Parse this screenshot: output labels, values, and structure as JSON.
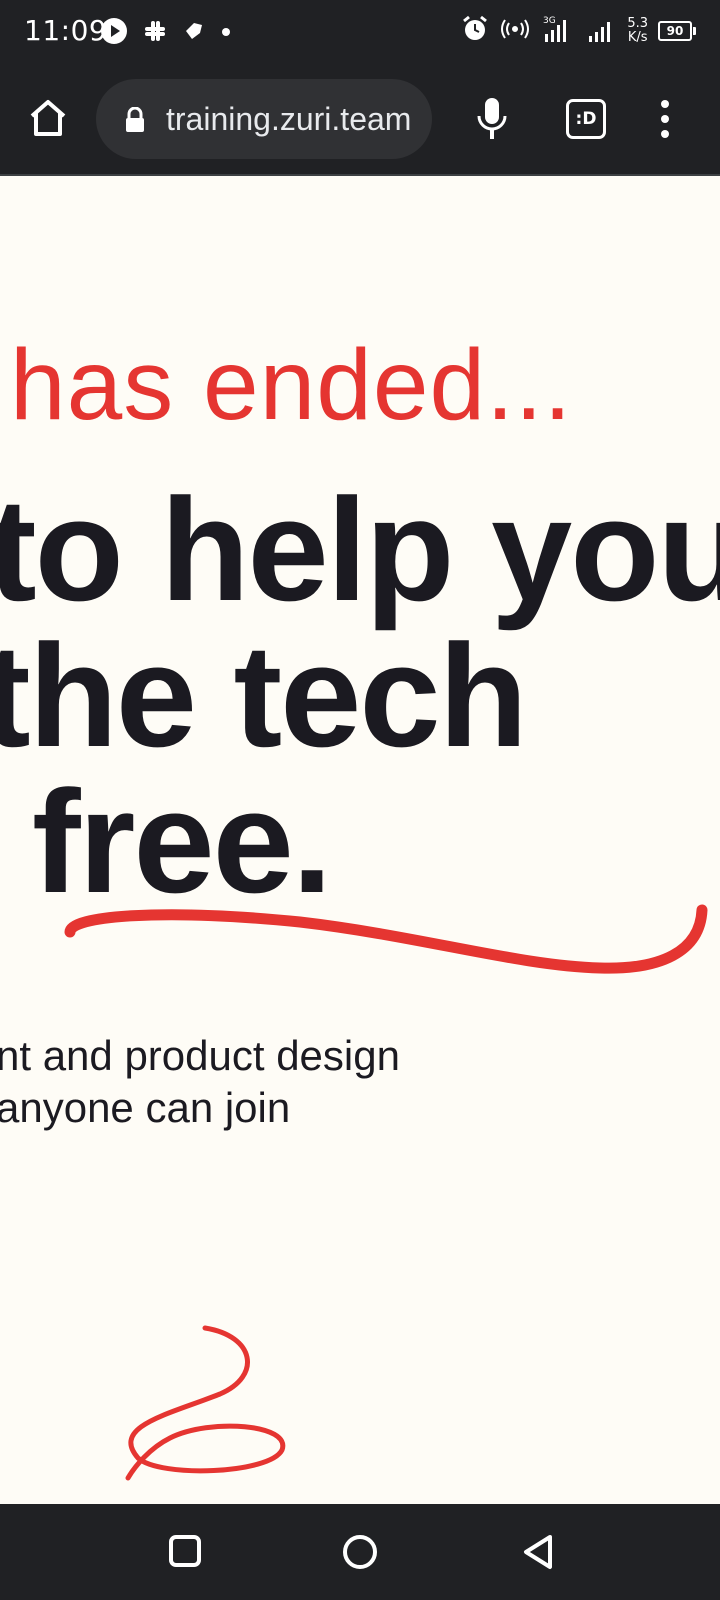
{
  "status_bar": {
    "time": "11:09",
    "net_speed_value": "5.3",
    "net_speed_unit": "K/s",
    "battery": "90",
    "network_label": "3G"
  },
  "toolbar": {
    "url": "training.zuri.team",
    "tabs_label": ":D"
  },
  "page": {
    "subtitle": "has ended...",
    "headline_lines": [
      "to help you",
      "the tech",
      "free."
    ],
    "body_lines": [
      "nt and product design",
      "anyone can join"
    ],
    "accent_color": "#e53531",
    "text_color": "#1b1a21",
    "background_color": "#fefcf6"
  },
  "nav_bar": {
    "buttons": [
      "recents",
      "home",
      "back"
    ]
  }
}
